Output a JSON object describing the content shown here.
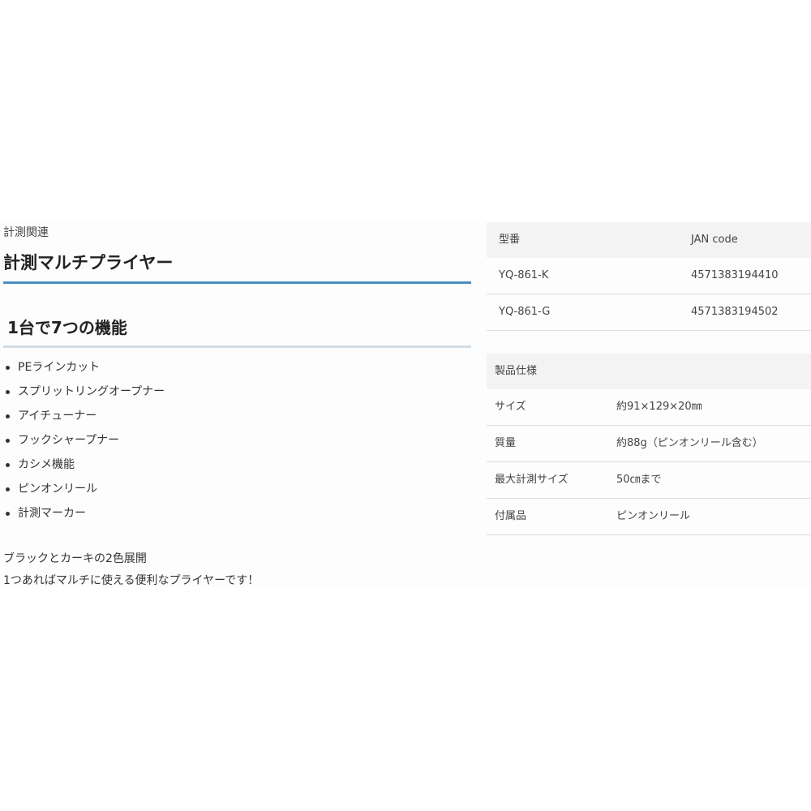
{
  "category": "計測関連",
  "product_title": "計測マルチプライヤー",
  "features_heading": "1台で7つの機能",
  "features": [
    "PEラインカット",
    "スプリットリングオープナー",
    "アイチューナー",
    "フックシャープナー",
    "カシメ機能",
    "ピンオンリール",
    "計測マーカー"
  ],
  "description": [
    "ブラックとカーキの2色展開",
    "1つあればマルチに使える便利なプライヤーです！"
  ],
  "model_table": {
    "header": [
      "型番",
      "JAN code"
    ],
    "rows": [
      [
        "YQ-861-K",
        "4571383194410"
      ],
      [
        "YQ-861-G",
        "4571383194502"
      ]
    ]
  },
  "spec_table": {
    "header": "製品仕様",
    "rows": [
      [
        "サイズ",
        "約91×129×20㎜"
      ],
      [
        "質量",
        "約88g（ピンオンリール含む）"
      ],
      [
        "最大計測サイズ",
        "50㎝まで"
      ],
      [
        "付属品",
        "ピンオンリール"
      ]
    ]
  },
  "colors": {
    "title_rule": "#4a90c2",
    "heading_rule": "#d3dde5",
    "table_header_bg": "#f3f3f3"
  }
}
